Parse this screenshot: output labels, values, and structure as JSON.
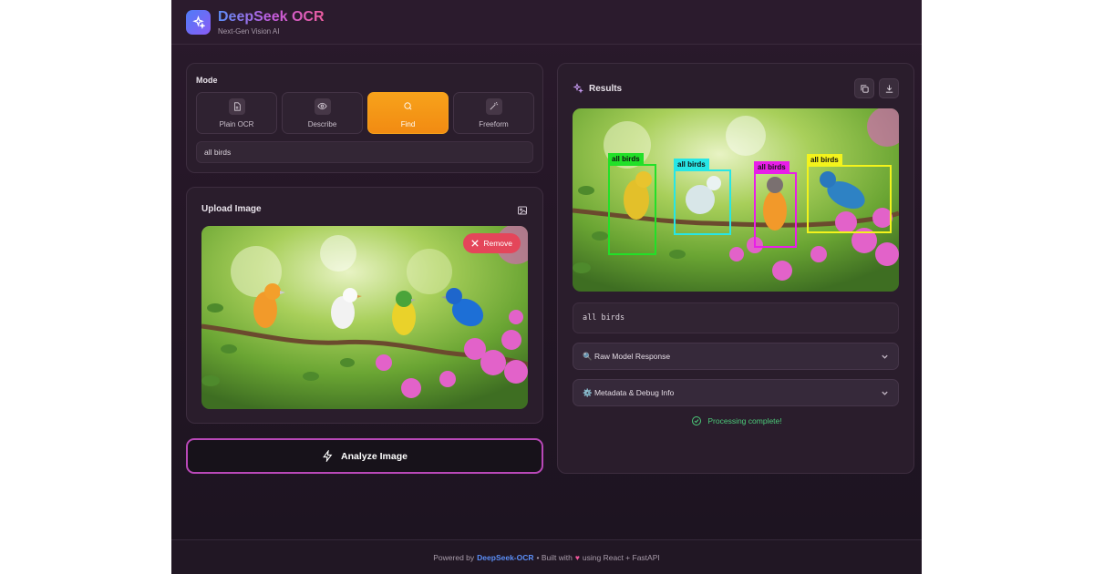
{
  "app": {
    "title": "DeepSeek OCR",
    "subtitle": "Next-Gen Vision AI"
  },
  "mode": {
    "label": "Mode",
    "options": [
      {
        "label": "Plain OCR",
        "icon": "document-icon"
      },
      {
        "label": "Describe",
        "icon": "eye-icon"
      },
      {
        "label": "Find",
        "icon": "search-icon"
      },
      {
        "label": "Freeform",
        "icon": "magic-wand-icon"
      }
    ],
    "selected": "Find",
    "query_value": "all birds"
  },
  "upload": {
    "title": "Upload Image",
    "remove_label": "Remove"
  },
  "analyze": {
    "label": "Analyze Image"
  },
  "results": {
    "title": "Results",
    "boxes": [
      {
        "label": "all birds",
        "color": "#22e028"
      },
      {
        "label": "all birds",
        "color": "#27e6e6"
      },
      {
        "label": "all birds",
        "color": "#e81ee8"
      },
      {
        "label": "all birds",
        "color": "#f3f31c"
      }
    ],
    "output_text": "all birds",
    "raw_label": "🔍 Raw Model Response",
    "meta_label": "⚙️ Metadata & Debug Info",
    "status": "Processing complete!"
  },
  "footer": {
    "prefix": "Powered by",
    "brand": "DeepSeek-OCR",
    "mid": "• Built with",
    "heart": "♥",
    "suffix": "using React + FastAPI"
  },
  "colors": {
    "accent_orange": "#f7a21b",
    "brand_blue": "#5b8ef7",
    "success": "#4ccb7a",
    "remove_red": "#e4465a"
  }
}
